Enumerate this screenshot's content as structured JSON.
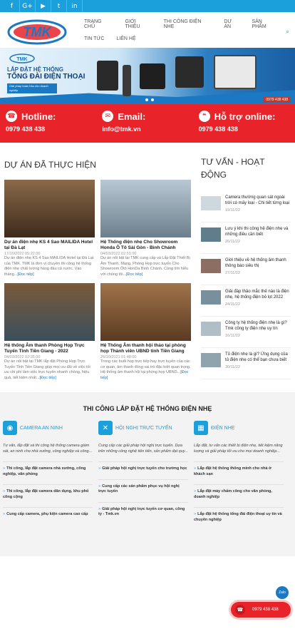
{
  "topbar": {
    "icons": [
      "facebook-icon",
      "google-plus-icon",
      "youtube-icon",
      "twitter-icon",
      "linkedin-icon"
    ],
    "glyphs": [
      "f",
      "G+",
      "▶",
      "t",
      "in"
    ]
  },
  "header": {
    "logo_text": "TMK",
    "nav_row1": [
      "Trang chủ",
      "Giới thiệu",
      "Thi công điện nhẹ",
      "Dự án",
      "Sản phẩm"
    ],
    "nav_row2": [
      "Tin tức",
      "Liên hệ"
    ]
  },
  "banner": {
    "line1": "LẮP ĐẶT HỆ THỐNG",
    "line2": "TỔNG ĐÀI ĐIỆN THOẠI",
    "sub": "Giải pháp hoàn hảo cho doanh nghiệp",
    "phone": "0979 438 438",
    "logo": "TMK"
  },
  "contact": [
    {
      "icon": "phone-icon",
      "glyph": "☎",
      "label": "Hotline:",
      "value": "0979 438 438"
    },
    {
      "icon": "email-icon",
      "glyph": "✉",
      "label": "Email:",
      "value": "info@tmk.vn"
    },
    {
      "icon": "chat-icon",
      "glyph": "❝",
      "label": "Hỗ trợ online:",
      "value": "0979 438 438"
    }
  ],
  "projects": {
    "title": "DỰ ÁN ĐÃ THỰC HIỆN",
    "more_label": "[Đọc tiếp]",
    "items": [
      {
        "title": "Dự án điện nhẹ KS 4 Sao MAILIDA Hotel tại Đà Lạt",
        "date": "17/10/2022 05:22:00",
        "excerpt": "Dự án điện nhẹ KS 4 Sao MAILIDA Hotel tại Đà Lạt của TMK. TMK là đơn vị chuyên thi công hệ thống điện nhẹ chất lượng hàng đầu cả nước. Vào tháng...",
        "colors": [
          "#8a6a4a",
          "#3d2a1c"
        ]
      },
      {
        "title": "Hệ Thống điện nhẹ Cho Showroom Honda Ô Tô Sài Gòn - Bình Chánh",
        "date": "04/03/2022 02:51:00",
        "excerpt": "Dự án nổi bật tại TMK cung cấp và Lắp Đặt Thiết Bị Âm Thanh, Mạng, Phòng Họp trực tuyến Cho Showroom Ôtô HonDa Bình Chánh. Cùng tìm hiểu với chúng tôi...",
        "colors": [
          "#b8c8d4",
          "#6d7f8c"
        ]
      },
      {
        "title": "Hệ thống Âm thanh Phòng Họp Trực Tuyến Tỉnh Tiền Giang - 2022",
        "date": "04/03/2022 02:35:00",
        "excerpt": "Dự án nổi bật tại TMK lắp đặt Phòng Họp Trực Tuyến Tỉnh Tiền Giang giúp mọi ưu đãi về việc tối ưu chi phí làm việc trực tuyến nhanh chóng, hiệu quả, tiết kiệm nhất...",
        "colors": [
          "#7a5a3a",
          "#3a4f5c"
        ]
      },
      {
        "title": "Hệ Thống Âm thanh hội thảo tại phòng họp Thành viên UBND tỉnh Tiền Giang",
        "date": "25/10/2021 01:48:00",
        "excerpt": "Trong các buổi họp trực tiếp hay trực tuyến của các cơ quan, âm thanh đóng vai trò đặc biệt quan trọng. Hệ thống âm thanh hội tại phòng họp UBND...",
        "colors": [
          "#a0744a",
          "#5a3a22"
        ]
      }
    ]
  },
  "news": {
    "title": "TƯ VẤN - HOẠT ĐỘNG",
    "items": [
      {
        "title": "Camera thường quan sát ngoài trời có mấy loại - Chi tiết từng loại",
        "date": "19/11/22"
      },
      {
        "title": "Lưu ý khi thi công hệ điện nhẹ và những điều cần biết",
        "date": "26/11/22"
      },
      {
        "title": "Giới thiệu về hệ thống âm thanh thông báo siêu thị",
        "date": "27/11/22"
      },
      {
        "title": "Giải đáp thảo mắc thế nào là điện nhẹ, hệ thống điện bỏ lọt 2022",
        "date": "24/11/22"
      },
      {
        "title": "Công ty hệ thống điện nhẹ là gì? Tmk công ty điện nhẹ uy tín",
        "date": "16/11/22"
      },
      {
        "title": "Tủ điện nhẹ là gì? Ứng dụng của tủ điện nhẹ có thể bạn chưa biết",
        "date": "30/11/22"
      }
    ]
  },
  "services": {
    "title": "THI CÔNG LẮP ĐẶT HỆ THỐNG ĐIỆN NHẸ",
    "cols": [
      {
        "icon": "camera-icon",
        "glyph": "◉",
        "name": "CAMERA AN NINH",
        "desc": "Tư vấn, lắp đặt và thi công hệ thống camera giám sát, an ninh cho nhà xưởng, công nghiệp và công...",
        "items": [
          "Thi công, lắp đặt camera nhà xưởng, công nghiệp, văn phòng",
          "Thi công, lắp đặt camera dân dụng, khu phố công cộng",
          "Cung cấp camera, phụ kiện camera cao cấp"
        ]
      },
      {
        "icon": "tools-icon",
        "glyph": "✕",
        "name": "HỘI NGHỊ TRỰC TUYẾN",
        "desc": "Cung cấp các giải pháp hội nghị trực tuyến. Dựa trên những công nghệ tiên tiến, sản phẩm đạt quy...",
        "items": [
          "Giải pháp hội nghị trực tuyến cho trường học",
          "Cung cấp các sản phẩm phục vụ hội nghị trực tuyến",
          "Giải pháp hội nghị trực tuyến cơ quan, công ty - Tmk.vn"
        ]
      },
      {
        "icon": "building-icon",
        "glyph": "▦",
        "name": "ĐIỆN NHẸ",
        "desc": "Lắp đặt, tư vấn các thiết bị điện nhẹ, tiết kiệm năng lượng và giải pháp tối ưu cho mọi doanh nghiệp...",
        "items": [
          "Lắp đặt hệ thống thông minh cho nhà ở khách sạn",
          "Lắp đặt máy chấm công cho văn phòng, doanh nghiệp",
          "Lắp đặt hệ thống tổng đài điện thoại uy tín và chuyên nghiệp"
        ]
      }
    ]
  },
  "float": {
    "hotline": "0979 438 438",
    "zalo": "Zalo"
  }
}
